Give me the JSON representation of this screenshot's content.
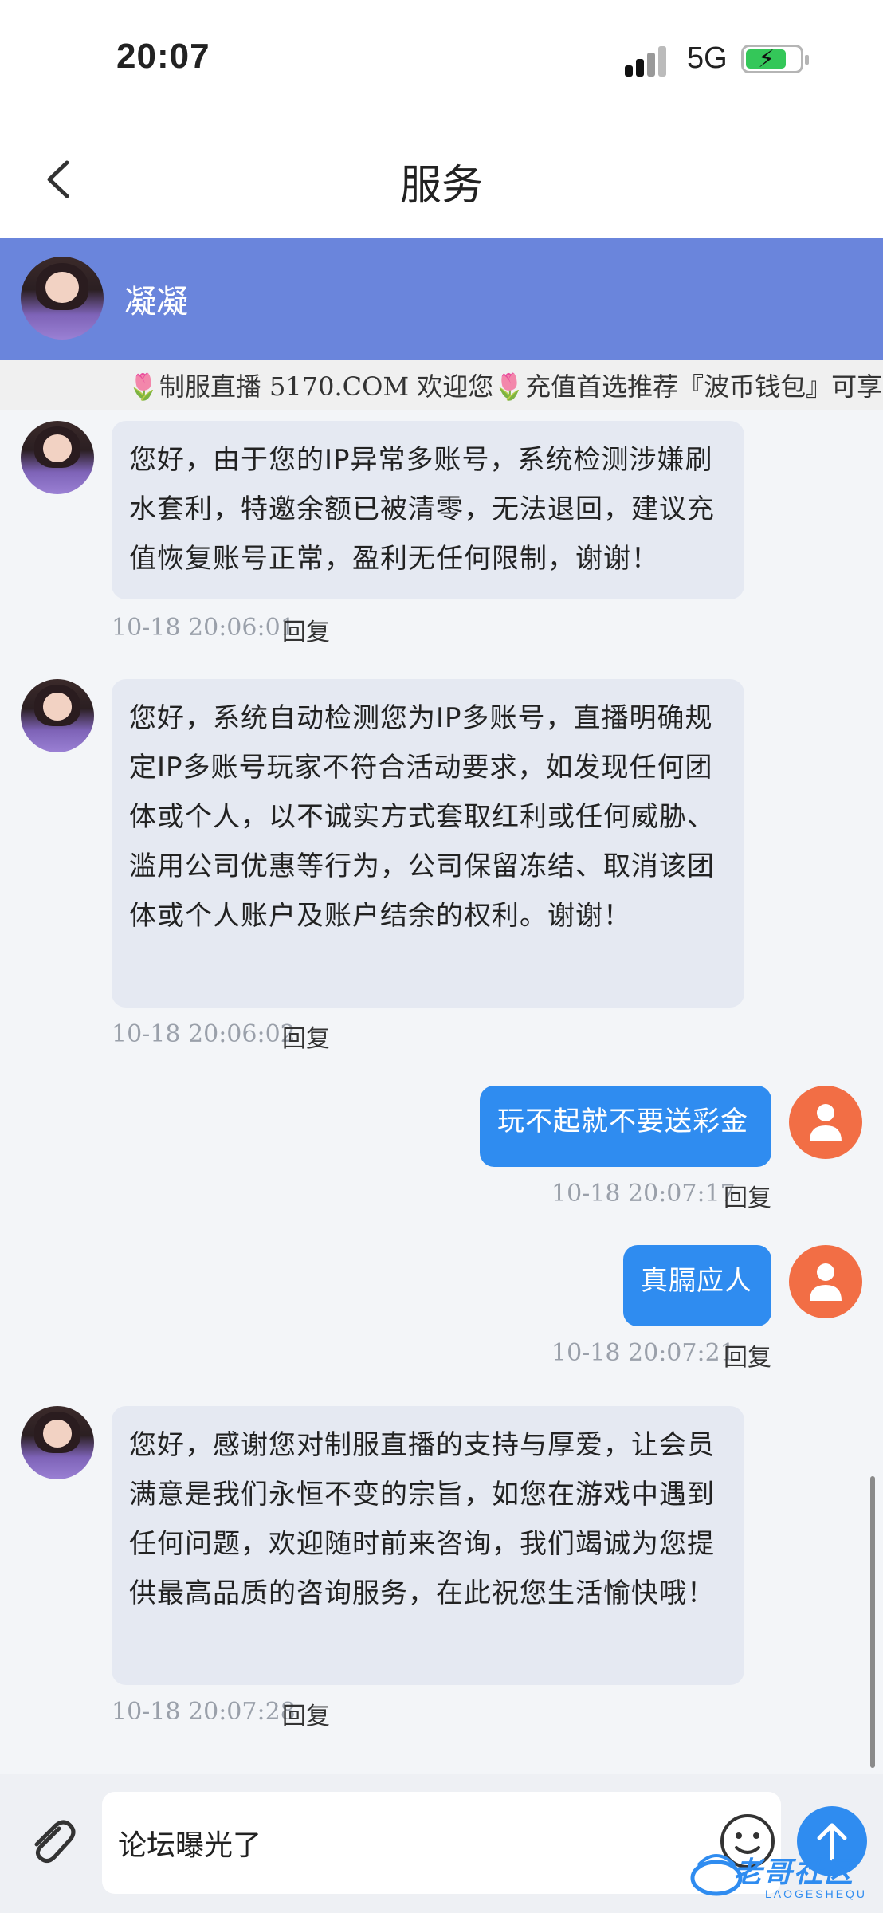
{
  "status_bar": {
    "time": "20:07",
    "network": "5G"
  },
  "header": {
    "title": "服务"
  },
  "agent": {
    "name": "凝凝"
  },
  "marquee": {
    "text": "🌷制服直播 5170.COM 欢迎您🌷充值首选推荐『波币钱包』可享"
  },
  "messages": [
    {
      "text": "您好，由于您的IP异常多账号，系统检测涉嫌刷水套利，特邀余额已被清零，无法退回，建议充值恢复账号正常，盈利无任何限制，谢谢！",
      "time": "10-18 20:06:01",
      "reply": "回复"
    },
    {
      "text": "您好，系统自动检测您为IP多账号，直播明确规定IP多账号玩家不符合活动要求，如发现任何团体或个人，以不诚实方式套取红利或任何威胁、滥用公司优惠等行为，公司保留冻结、取消该团体或个人账户及账户结余的权利。谢谢！",
      "time": "10-18 20:06:02",
      "reply": "回复"
    },
    {
      "text": "玩不起就不要送彩金",
      "time": "10-18 20:07:17",
      "reply": "回复"
    },
    {
      "text": "真膈应人",
      "time": "10-18 20:07:21",
      "reply": "回复"
    },
    {
      "text": "您好，感谢您对制服直播的支持与厚爱，让会员满意是我们永恒不变的宗旨，如您在游戏中遇到任何问题，欢迎随时前来咨询，我们竭诚为您提供最高品质的咨询服务，在此祝您生活愉快哦！",
      "time": "10-18 20:07:28",
      "reply": "回复"
    }
  ],
  "input": {
    "value": "论坛曝光了"
  },
  "watermark": {
    "text": "老哥社区",
    "sub": "LAOGESHEQU"
  },
  "colors": {
    "banner": "#6a85dc",
    "my_bubble": "#2f8cf0",
    "agent_bubble": "#e5e9f2",
    "user_avatar": "#f26e45"
  }
}
